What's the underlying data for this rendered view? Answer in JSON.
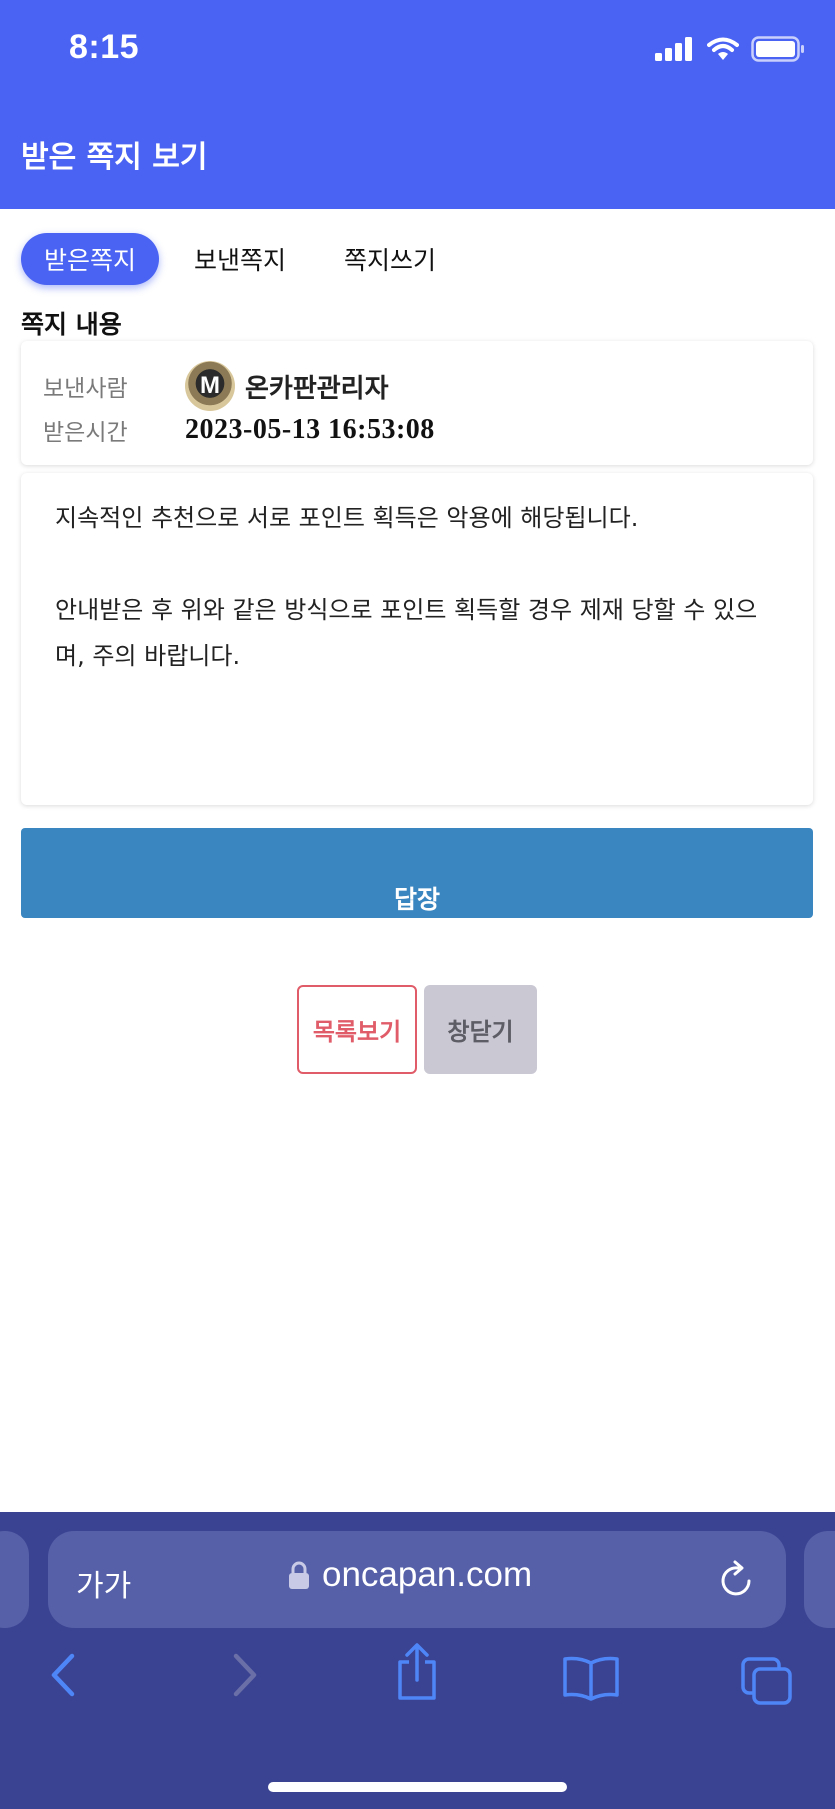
{
  "status_bar": {
    "time": "8:15"
  },
  "header": {
    "title": "받은 쪽지 보기"
  },
  "tabs": [
    {
      "label": "받은쪽지",
      "active": true
    },
    {
      "label": "보낸쪽지",
      "active": false
    },
    {
      "label": "쪽지쓰기",
      "active": false
    }
  ],
  "section": {
    "title": "쪽지 내용"
  },
  "info": {
    "sender_label": "보낸사람",
    "sender_name": "온카판관리자",
    "avatar_letter": "M",
    "time_label": "받은시간",
    "time_value": "2023-05-13 16:53:08"
  },
  "message": {
    "lines": [
      "지속적인 추천으로 서로 포인트 획득은 악용에 해당됩니다.",
      "",
      "안내받은 후 위와 같은 방식으로 포인트 획득할 경우 제재 당할 수 있으",
      "며, 주의 바랍니다."
    ]
  },
  "buttons": {
    "reply": "답장",
    "list": "목록보기",
    "close": "창닫기"
  },
  "browser": {
    "text_size": "가가",
    "url": "oncapan.com"
  },
  "colors": {
    "primary": "#4a63f2",
    "reply": "#3a86c0",
    "list_border": "#e05c68",
    "browser_bg": "#3a4392"
  },
  "icons": [
    "signal-icon",
    "wifi-icon",
    "battery-icon",
    "lock-icon",
    "reload-icon",
    "back-icon",
    "forward-icon",
    "share-icon",
    "bookmarks-icon",
    "tabs-icon"
  ]
}
